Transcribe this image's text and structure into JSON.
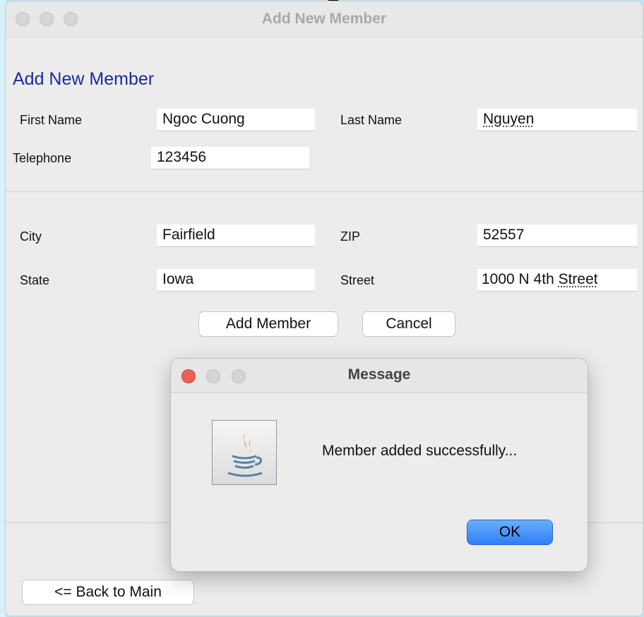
{
  "window": {
    "title": "Add New Member"
  },
  "form": {
    "heading": "Add New Member",
    "first_name": {
      "label": "First Name",
      "value": "Ngoc Cuong"
    },
    "last_name": {
      "label": "Last Name",
      "value": "Nguyen"
    },
    "telephone": {
      "label": "Telephone",
      "value": "123456"
    },
    "city": {
      "label": "City",
      "value": "Fairfield"
    },
    "zip": {
      "label": "ZIP",
      "value": "52557"
    },
    "state": {
      "label": "State",
      "value": "Iowa"
    },
    "street": {
      "label": "Street",
      "value_prefix": "1000 N 4th ",
      "value_suffix": "Street"
    },
    "add_button": "Add Member",
    "cancel_button": "Cancel",
    "back_button": "<= Back to Main"
  },
  "dialog": {
    "title": "Message",
    "message": "Member added successfully...",
    "ok_button": "OK",
    "icon": "java-coffee-cup-icon"
  },
  "colors": {
    "heading": "#1d2a9c",
    "ok_button": "#2f7ff6",
    "close_light": "#ec5f56"
  }
}
